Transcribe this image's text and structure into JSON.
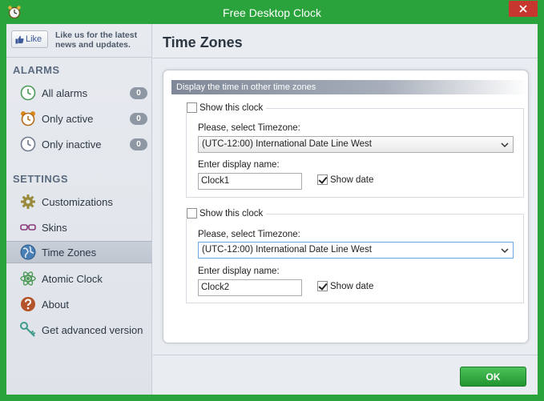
{
  "window": {
    "title": "Free Desktop Clock",
    "close_icon": "close-icon"
  },
  "sidebar": {
    "like": {
      "button_label": "Like",
      "text": "Like us for the latest news and updates."
    },
    "alarms_title": "ALARMS",
    "alarms": [
      {
        "label": "All alarms",
        "count": "0",
        "icon": "clock-icon"
      },
      {
        "label": "Only active",
        "count": "0",
        "icon": "alarm-clock-icon"
      },
      {
        "label": "Only inactive",
        "count": "0",
        "icon": "clock-inactive-icon"
      }
    ],
    "settings_title": "SETTINGS",
    "settings": [
      {
        "label": "Customizations",
        "icon": "gear-icon"
      },
      {
        "label": "Skins",
        "icon": "glasses-icon"
      },
      {
        "label": "Time Zones",
        "icon": "globe-icon",
        "active": true
      },
      {
        "label": "Atomic Clock",
        "icon": "atom-icon"
      },
      {
        "label": "About",
        "icon": "question-icon"
      },
      {
        "label": "Get advanced version",
        "icon": "key-icon"
      }
    ]
  },
  "main": {
    "title": "Time Zones",
    "panel_header": "Display the time in other time zones",
    "clocks": [
      {
        "show_label": "Show this clock",
        "show_checked": false,
        "timezone_label": "Please, select Timezone:",
        "timezone_value": "(UTC-12:00) International Date Line West",
        "name_label": "Enter display  name:",
        "name_value": "Clock1",
        "show_date_label": "Show date",
        "show_date_checked": true
      },
      {
        "show_label": "Show this clock",
        "show_checked": false,
        "timezone_label": "Please, select Timezone:",
        "timezone_value": "(UTC-12:00) International Date Line West",
        "name_label": "Enter display  name:",
        "name_value": "Clock2",
        "show_date_label": "Show date",
        "show_date_checked": true
      }
    ],
    "ok_label": "OK"
  },
  "colors": {
    "frame": "#2ba33c",
    "accent": "#2ba33c",
    "badge": "#8e97a4",
    "close": "#c7372f"
  }
}
